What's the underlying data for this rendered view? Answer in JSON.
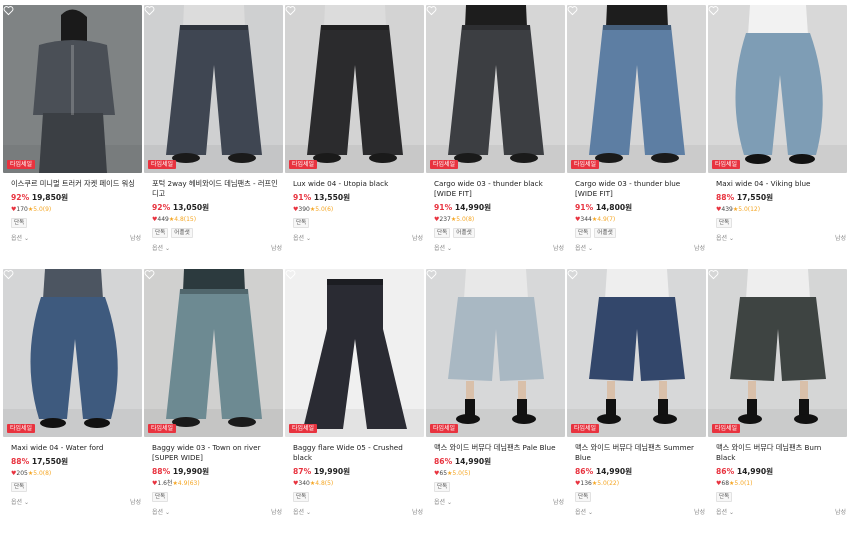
{
  "colors": {
    "accent": "#e8333f",
    "star": "#f5a623"
  },
  "products": [
    {
      "name": "이스쿠르 미니멀 트러커 자켓 페이드 워싱",
      "discount": "92%",
      "price": "19,850원",
      "likes": "170",
      "rating": "5.0(9)",
      "tags": [
        "단독"
      ],
      "badge": "타임세일",
      "option": "옵션",
      "gender": "남성",
      "bg": "#7f8384",
      "fabric": "#3b3f44",
      "shirt": "#4a4f56",
      "type": "jacket"
    },
    {
      "name": "포턱 2way 헤비와이드 데님팬츠 - 러프인디고",
      "discount": "92%",
      "price": "13,050원",
      "likes": "449",
      "rating": "4.8(15)",
      "tags": [
        "단독",
        "어플샛"
      ],
      "badge": "타임세일",
      "option": "옵션",
      "gender": "남성",
      "bg": "#cfd0d1",
      "fabric": "#3f4652",
      "shirt": "#dcdcdc",
      "type": "wide"
    },
    {
      "name": "Lux wide 04 - Utopia black",
      "discount": "91%",
      "price": "13,550원",
      "likes": "390",
      "rating": "5.0(6)",
      "tags": [
        "단독"
      ],
      "badge": "타임세일",
      "option": "옵션",
      "gender": "남성",
      "bg": "#d3d3d3",
      "fabric": "#2b2b2d",
      "shirt": "#dcdcdc",
      "type": "wide"
    },
    {
      "name": "Cargo wide 03 - thunder black [WIDE FIT]",
      "discount": "91%",
      "price": "14,990원",
      "likes": "237",
      "rating": "5.0(8)",
      "tags": [
        "단독",
        "어플샛"
      ],
      "badge": "타임세일",
      "option": "옵션",
      "gender": "남성",
      "bg": "#d6d6d6",
      "fabric": "#3c3e42",
      "shirt": "#1d1d1d",
      "type": "wide"
    },
    {
      "name": "Cargo wide 03 - thunder blue [WIDE FIT]",
      "discount": "91%",
      "price": "14,800원",
      "likes": "344",
      "rating": "4.9(7)",
      "tags": [
        "단독",
        "어플샛"
      ],
      "badge": "타임세일",
      "option": "옵션",
      "gender": "남성",
      "bg": "#d6d6d6",
      "fabric": "#5d7ea3",
      "shirt": "#1d1d1d",
      "type": "wide"
    },
    {
      "name": "Maxi wide 04 - Viking blue",
      "discount": "88%",
      "price": "17,550원",
      "likes": "439",
      "rating": "5.0(12)",
      "tags": [
        "단독"
      ],
      "badge": "타임세일",
      "option": "옵션",
      "gender": "남성",
      "bg": "#d8d8d8",
      "fabric": "#7e9db5",
      "shirt": "#f2f2f2",
      "type": "balloon"
    },
    {
      "name": "Maxi wide 04 - Water ford",
      "discount": "88%",
      "price": "17,550원",
      "likes": "205",
      "rating": "5.0(8)",
      "tags": [
        "단독"
      ],
      "badge": "타임세일",
      "option": "옵션",
      "gender": "남성",
      "bg": "#d4d5d6",
      "fabric": "#3e5a7e",
      "shirt": "#4c5561",
      "type": "balloon"
    },
    {
      "name": "Baggy wide 03 - Town on river [SUPER WIDE]",
      "discount": "88%",
      "price": "19,990원",
      "likes": "1.6천",
      "rating": "4.9(63)",
      "tags": [
        "단독"
      ],
      "badge": "타임세일",
      "option": "옵션",
      "gender": "남성",
      "bg": "#d0d0cf",
      "fabric": "#6d8a92",
      "shirt": "#2c3a3e",
      "type": "wide"
    },
    {
      "name": "Baggy flare Wide 05 - Crushed black",
      "discount": "87%",
      "price": "19,990원",
      "likes": "340",
      "rating": "4.8(5)",
      "tags": [
        "단독"
      ],
      "badge": "타임세일",
      "option": "옵션",
      "gender": "남성",
      "bg": "#f0f0f0",
      "fabric": "#2a2b33",
      "shirt": "#f0f0f0",
      "type": "flat"
    },
    {
      "name": "맥스 와이드 버뮤다 데님팬츠 Pale Blue",
      "discount": "86%",
      "price": "14,990원",
      "likes": "65",
      "rating": "5.0(5)",
      "tags": [
        "단독"
      ],
      "badge": "타임세일",
      "option": "옵션",
      "gender": "남성",
      "bg": "#d7d8d9",
      "fabric": "#a9b8c3",
      "shirt": "#e8e8e8",
      "type": "shorts"
    },
    {
      "name": "맥스 와이드 버뮤다 데님팬츠 Summer Blue",
      "discount": "86%",
      "price": "14,990원",
      "likes": "136",
      "rating": "5.0(22)",
      "tags": [
        "단독"
      ],
      "badge": "타임세일",
      "option": "옵션",
      "gender": "남성",
      "bg": "#d7d8d9",
      "fabric": "#33476b",
      "shirt": "#eeeeee",
      "type": "shorts"
    },
    {
      "name": "맥스 와이드 버뮤다 데님팬츠 Burn Black",
      "discount": "86%",
      "price": "14,990원",
      "likes": "68",
      "rating": "5.0(1)",
      "tags": [
        "단독"
      ],
      "badge": "타임세일",
      "option": "옵션",
      "gender": "남성",
      "bg": "#d5d6d6",
      "fabric": "#3e4442",
      "shirt": "#eeeeee",
      "type": "shorts"
    }
  ]
}
